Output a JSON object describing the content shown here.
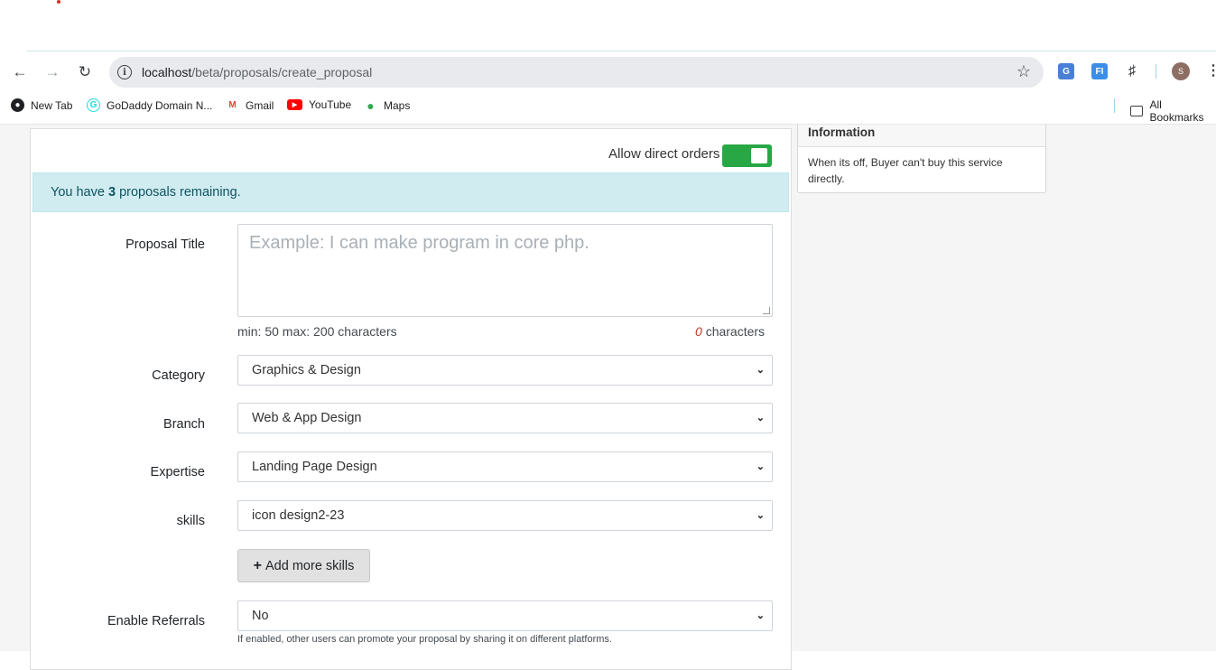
{
  "browser": {
    "url_host": "localhost",
    "url_path": "/beta/proposals/create_proposal",
    "bookmarks": [
      {
        "label": "New Tab",
        "icon": "globe-icon"
      },
      {
        "label": "GoDaddy Domain N...",
        "icon": "godaddy-icon"
      },
      {
        "label": "Gmail",
        "icon": "gmail-icon"
      },
      {
        "label": "YouTube",
        "icon": "youtube-icon"
      },
      {
        "label": "Maps",
        "icon": "maps-icon"
      }
    ],
    "all_bookmarks": "All Bookmarks",
    "avatar_letter": "S",
    "ext_fi": "FI"
  },
  "form": {
    "direct_orders_label": "Allow direct orders",
    "direct_orders_enabled": true,
    "alert_prefix": "You have",
    "alert_count": "3",
    "alert_suffix": "proposals remaining.",
    "title_label": "Proposal Title",
    "title_placeholder": "Example: I can make program in core php.",
    "title_limits": "min: 50 max: 200 characters",
    "title_count": "0",
    "title_count_suffix": "characters",
    "category_label": "Category",
    "category_value": "Graphics & Design",
    "branch_label": "Branch",
    "branch_value": "Web & App Design",
    "expertise_label": "Expertise",
    "expertise_value": "Landing Page Design",
    "skills_label": "skills",
    "skills_value": "icon design2-23",
    "add_skills_label": "Add more skills",
    "referrals_label": "Enable Referrals",
    "referrals_value": "No",
    "referrals_hint": "If enabled, other users can promote your proposal by sharing it on different platforms."
  },
  "info_panel": {
    "title": "Information",
    "body": "When its off, Buyer can't buy this service directly."
  },
  "colors": {
    "toggle_on": "#28a745",
    "alert_bg": "#d1ecf1",
    "alert_text": "#0c5460"
  }
}
